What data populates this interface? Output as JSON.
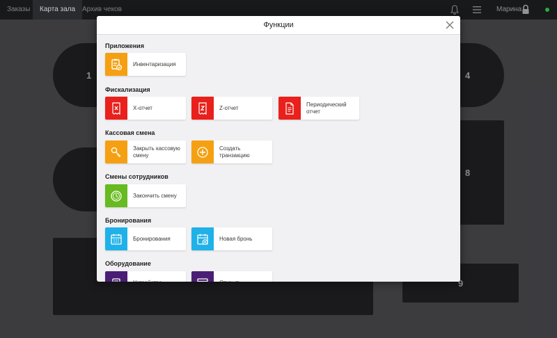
{
  "topbar": {
    "tabs": [
      {
        "label": "Заказы"
      },
      {
        "label": "Карта зала"
      },
      {
        "label": "Архив чеков"
      }
    ],
    "active_tab": "Карта зала",
    "user_name": "Марина"
  },
  "floor": {
    "tables": [
      {
        "number": "1"
      },
      {
        "number": "4"
      },
      {
        "number": "8"
      },
      {
        "number": "9"
      }
    ]
  },
  "modal": {
    "title": "Функции",
    "sections": [
      {
        "title": "Приложения",
        "tiles": [
          {
            "label": "Инвентаризация",
            "icon": "inventory-clipboard-icon",
            "color": "#f5a012"
          }
        ]
      },
      {
        "title": "Фискализация",
        "tiles": [
          {
            "label": "X-отчет",
            "icon": "x-report-icon",
            "color": "#e9201c"
          },
          {
            "label": "Z-отчет",
            "icon": "z-report-icon",
            "color": "#e9201c"
          },
          {
            "label": "Периодический отчет",
            "icon": "periodic-report-icon",
            "color": "#e9201c"
          }
        ]
      },
      {
        "title": "Кассовая смена",
        "tiles": [
          {
            "label": "Закрыть кассовую смену",
            "icon": "key-icon",
            "color": "#f5a012"
          },
          {
            "label": "Создать транзакцию",
            "icon": "plus-circle-icon",
            "color": "#f5a012"
          }
        ]
      },
      {
        "title": "Смены сотрудников",
        "tiles": [
          {
            "label": "Закончить смену",
            "icon": "clock-icon",
            "color": "#67ba1f"
          }
        ]
      },
      {
        "title": "Бронирования",
        "tiles": [
          {
            "label": "Бронирования",
            "icon": "calendar-icon",
            "color": "#1fb1e8"
          },
          {
            "label": "Новая бронь",
            "icon": "calendar-add-icon",
            "color": "#1fb1e8"
          }
        ]
      },
      {
        "title": "Оборудование",
        "tiles": [
          {
            "label": "Устройства",
            "icon": "device-icon",
            "color": "#4a1e74"
          },
          {
            "label": "Открыть",
            "icon": "window-icon",
            "color": "#4a1e74"
          }
        ]
      }
    ]
  }
}
